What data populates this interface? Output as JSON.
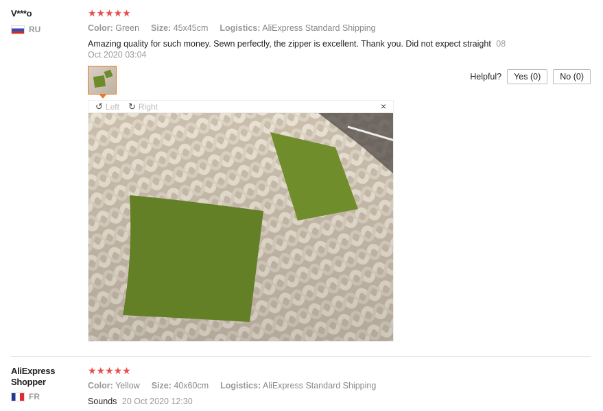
{
  "reviews": [
    {
      "user": "V***o",
      "country": "RU",
      "rating": 5,
      "stars": "★★★★★",
      "color_label": "Color:",
      "color_value": "Green",
      "size_label": "Size:",
      "size_value": "45x45cm",
      "logistics_label": "Logistics:",
      "logistics_value": "AliExpress Standard Shipping",
      "text": "Amazing quality for such money. Sewn perfectly, the zipper is excellent. Thank you. Did not expect straight",
      "date": "08 Oct 2020 03:04",
      "helpful_label": "Helpful?",
      "yes_label": "Yes (0)",
      "no_label": "No (0)",
      "viewer": {
        "left_label": "Left",
        "right_label": "Right",
        "close_glyph": "×"
      }
    },
    {
      "user": "AliExpress Shopper",
      "country": "FR",
      "rating": 5,
      "stars": "★★★★★",
      "color_label": "Color:",
      "color_value": "Yellow",
      "size_label": "Size:",
      "size_value": "40x60cm",
      "logistics_label": "Logistics:",
      "logistics_value": "AliExpress Standard Shipping",
      "text": "Sounds",
      "date": "20 Oct 2020 12:30"
    }
  ],
  "colors": {
    "star": "#e84b4b",
    "accent": "#e8792a",
    "pillow": "#6d8b2a"
  }
}
